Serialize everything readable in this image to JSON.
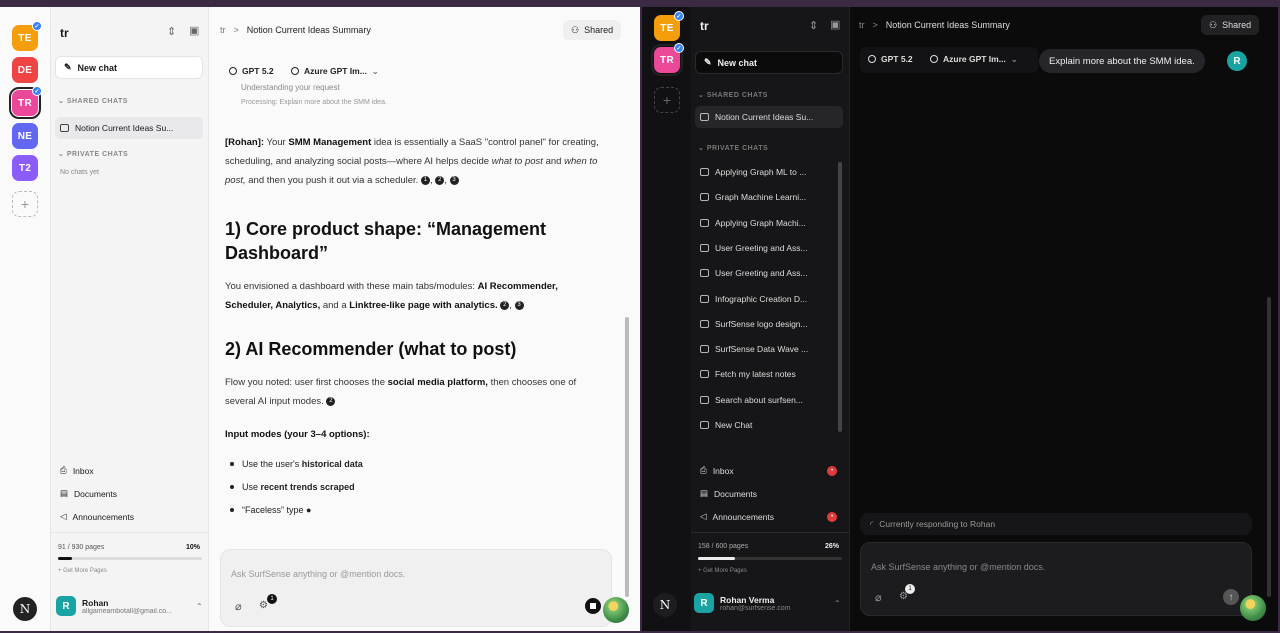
{
  "left": {
    "workspaces": [
      {
        "label": "TE",
        "color": "#f59e0b",
        "badge": true
      },
      {
        "label": "DE",
        "color": "#ef4444",
        "badge": false
      },
      {
        "label": "TR",
        "color": "#ec4899",
        "badge": true,
        "selected": true
      },
      {
        "label": "NE",
        "color": "#6366f1",
        "badge": false
      },
      {
        "label": "T2",
        "color": "#8b5cf6",
        "badge": false
      }
    ],
    "add_workspace": "+",
    "sidebar": {
      "title": "tr",
      "new_chat": "New chat",
      "shared_chats_header": "SHARED CHATS",
      "shared_chats": [
        "Notion Current Ideas Su..."
      ],
      "private_chats_header": "PRIVATE CHATS",
      "private_empty": "No chats yet",
      "links": [
        "Inbox",
        "Documents",
        "Announcements"
      ],
      "pages_used": "91 / 930 pages",
      "pages_pct": "10%",
      "pages_fraction": 0.1,
      "get_more": "+ Get More Pages",
      "user_name": "Rohan",
      "user_email": "allgameambotall@gmail.co...",
      "user_initial": "R"
    },
    "corner_initial": "N",
    "header": {
      "crumb_root": "tr",
      "crumb_sep": ">",
      "crumb_title": "Notion Current Ideas Summary",
      "shared": "Shared"
    },
    "chips": {
      "model": "GPT 5.2",
      "image_model": "Azure GPT Im..."
    },
    "status": {
      "line1": "Understanding your request",
      "line2": "Processing: Explain more about the SMM idea."
    },
    "answer": {
      "p1_name": "[Rohan]:",
      "p1_a": "Your",
      "p1_bold": "SMM Management",
      "p1_b": "idea is essentially a SaaS \"control panel\" for creating, scheduling, and analyzing social posts—where AI helps decide",
      "p1_i1": "what to post",
      "p1_c": "and",
      "p1_i2": "when to post,",
      "p1_d": "and then you push it out via a scheduler.",
      "p1_cites": [
        "1",
        "2",
        "3"
      ],
      "h1": "1) Core product shape: “Management Dashboard”",
      "p2_a": "You envisioned a dashboard with these main tabs/modules:",
      "p2_b1": "AI Recommender,",
      "p2_b2": "Scheduler, Analytics,",
      "p2_c": "and a",
      "p2_b3": "Linktree-like page with analytics.",
      "p2_cites": [
        "2",
        "3"
      ],
      "h2": "2) AI Recommender (what to post)",
      "p3_a": "Flow you noted: user first chooses the",
      "p3_b": "social media platform,",
      "p3_c": "then chooses one of several AI input modes.",
      "p3_cites": [
        "2"
      ],
      "h3": "Input modes (your 3–4 options):",
      "b1_a": "Use the user's",
      "b1_b": "historical data",
      "b2_a": "Use",
      "b2_b": "recent trends scraped",
      "b3": "“Faceless” type ●"
    },
    "composer": {
      "placeholder": "Ask SurfSense anything or @mention docs.",
      "attach_count": "1"
    }
  },
  "right": {
    "workspaces": [
      {
        "label": "TE",
        "color": "#f59e0b",
        "badge": true
      },
      {
        "label": "TR",
        "color": "#ec4899",
        "badge": true,
        "selected": true
      }
    ],
    "add_workspace": "+",
    "sidebar": {
      "title": "tr",
      "new_chat": "New chat",
      "shared_chats_header": "SHARED CHATS",
      "shared_chats": [
        "Notion Current Ideas Su..."
      ],
      "private_chats_header": "PRIVATE CHATS",
      "private_chats": [
        "Applying Graph ML to ...",
        "Graph Machine Learni...",
        "Applying Graph Machi...",
        "User Greeting and Ass...",
        "User Greeting and Ass...",
        "Infographic Creation D...",
        "SurfSense logo design...",
        "SurfSense Data Wave ...",
        "Fetch my latest notes",
        "Search about surfsen...",
        "New Chat"
      ],
      "links": [
        "Inbox",
        "Documents",
        "Announcements"
      ],
      "pages_used": "158 / 600 pages",
      "pages_pct": "26%",
      "pages_fraction": 0.26,
      "get_more": "+ Get More Pages",
      "user_name": "Rohan Verma",
      "user_email": "rohan@surfsense.com",
      "user_initial": "R"
    },
    "corner_initial": "N",
    "header": {
      "crumb_root": "tr",
      "crumb_sep": ">",
      "crumb_title": "Notion Current Ideas Summary",
      "shared": "Shared"
    },
    "chips": {
      "model": "GPT 5.2",
      "image_model": "Azure GPT Im..."
    },
    "user_message": "Explain more about the SMM idea.",
    "user_initial": "R",
    "responding": "Currently responding to Rohan",
    "composer": {
      "placeholder": "Ask SurfSense anything or @mention docs.",
      "attach_count": "1"
    }
  }
}
